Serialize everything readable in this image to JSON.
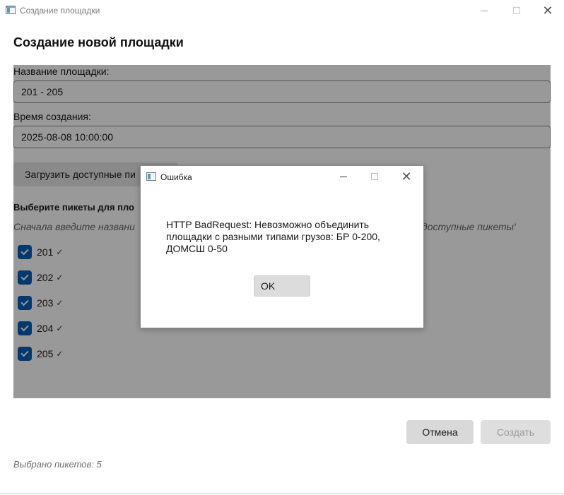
{
  "window": {
    "title": "Создание площадки"
  },
  "page": {
    "heading": "Создание новой площадки"
  },
  "form": {
    "name_label": "Название площадки:",
    "name_value": "201 - 205",
    "time_label": "Время создания:",
    "time_value": "2025-08-08 10:00:00",
    "load_button_label": "Загрузить доступные пи",
    "pickets_title": "Выберите пикеты для пло",
    "pickets_hint": "Сначала введите названи",
    "pickets_hint_tail": "доступные пикеты'",
    "pickets": [
      {
        "label": "201",
        "checked": true
      },
      {
        "label": "202",
        "checked": true
      },
      {
        "label": "203",
        "checked": true
      },
      {
        "label": "204",
        "checked": true
      },
      {
        "label": "205",
        "checked": true
      }
    ],
    "picket_tick_glyph": "✓"
  },
  "footer": {
    "cancel_label": "Отмена",
    "create_label": "Создать",
    "status": "Выбрано пикетов: 5"
  },
  "dialog": {
    "title": "Ошибка",
    "message": "HTTP BadRequest: Невозможно объединить площадки с разными типами грузов: БР 0-200, ДОМСШ 0-50",
    "ok_label": "OK"
  },
  "icons": {
    "close": "✕",
    "accent_color": "#005fb8"
  }
}
